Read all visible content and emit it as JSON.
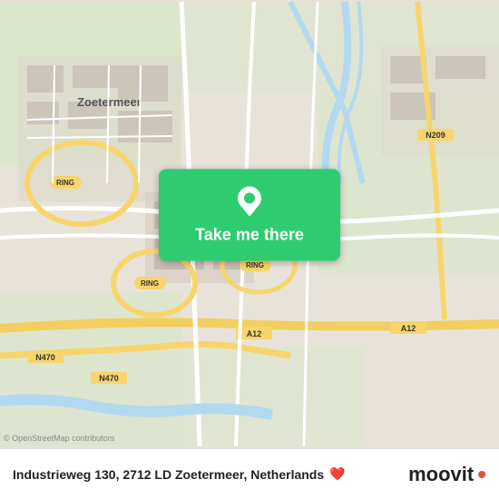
{
  "map": {
    "center_label": "Zoetermeer",
    "ring_label": "RING",
    "road_labels": [
      "N470",
      "A12",
      "N209"
    ],
    "attribution": "© OpenStreetMap contributors"
  },
  "button": {
    "label": "Take me there",
    "pin_icon": "location-pin"
  },
  "footer": {
    "address": "Industrieweg 130, 2712 LD Zoetermeer, Netherlands",
    "brand": "moovit",
    "heart_icon": "❤️"
  }
}
